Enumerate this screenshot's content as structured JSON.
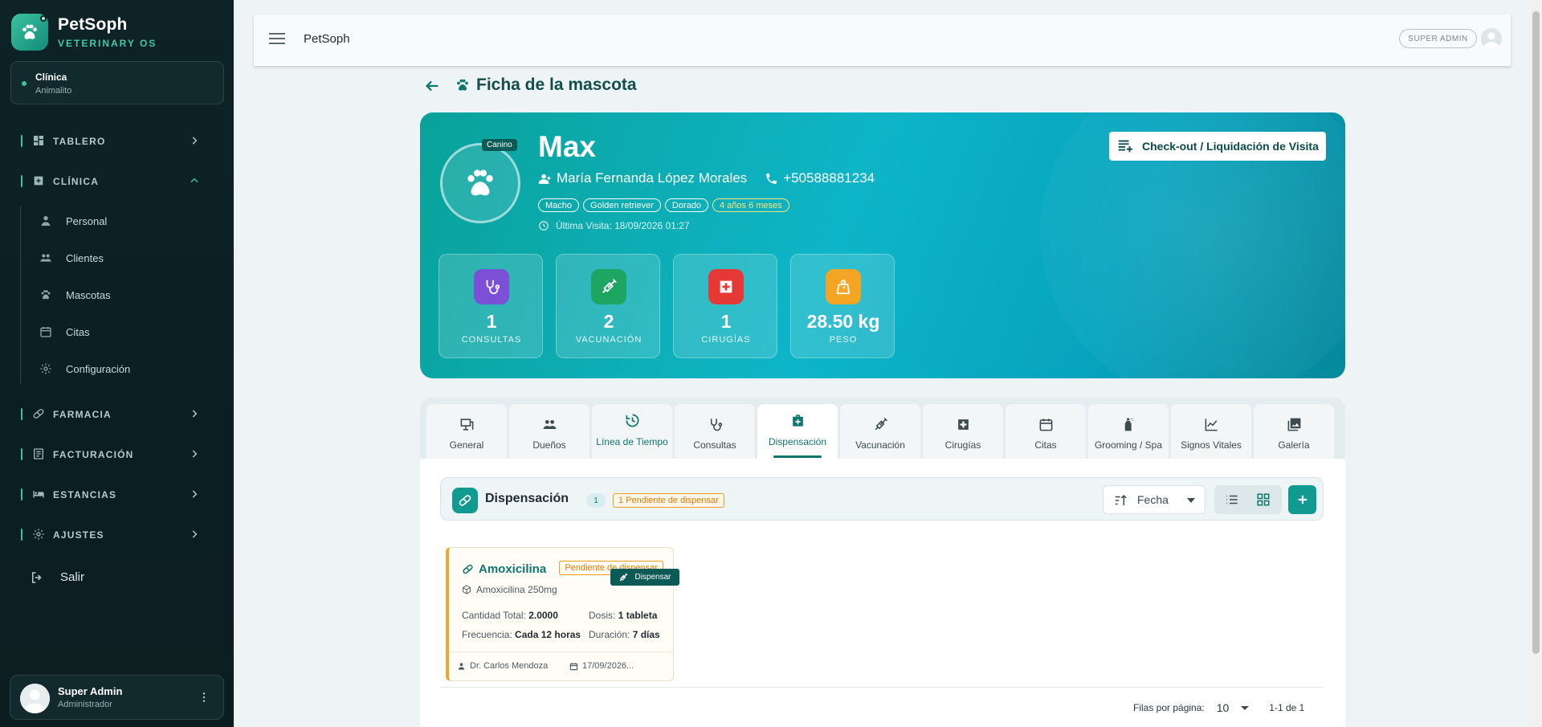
{
  "brand": {
    "name": "PetSoph",
    "subtitle": "VETERINARY OS"
  },
  "clinic": {
    "label": "Clínica",
    "name": "Animalito"
  },
  "sidebar": {
    "sections": [
      {
        "label": "TABLERO",
        "icon": "dashboard-icon",
        "expanded": false
      },
      {
        "label": "CLÍNICA",
        "icon": "medical-icon",
        "expanded": true
      },
      {
        "label": "FARMACIA",
        "icon": "pill-icon",
        "expanded": false
      },
      {
        "label": "FACTURACIÓN",
        "icon": "invoice-icon",
        "expanded": false
      },
      {
        "label": "ESTANCIAS",
        "icon": "bed-icon",
        "expanded": false
      },
      {
        "label": "AJUSTES",
        "icon": "gear-icon",
        "expanded": false
      }
    ],
    "clinic_items": [
      {
        "label": "Personal",
        "icon": "staff-icon"
      },
      {
        "label": "Clientes",
        "icon": "people-icon"
      },
      {
        "label": "Mascotas",
        "icon": "paw-icon"
      },
      {
        "label": "Citas",
        "icon": "calendar-icon"
      },
      {
        "label": "Configuración",
        "icon": "gear-icon"
      }
    ],
    "logout": "Salir"
  },
  "user": {
    "name": "Super Admin",
    "role": "Administrador"
  },
  "topbar": {
    "title": "PetSoph",
    "role_badge": "SUPER ADMIN"
  },
  "page": {
    "title": "Ficha de la mascota"
  },
  "pet": {
    "name": "Max",
    "species": "Canino",
    "owner": "María Fernanda López Morales",
    "phone": "+50588881234",
    "tags": [
      "Macho",
      "Golden retriever",
      "Dorado"
    ],
    "age": "4 años 6 meses",
    "last_visit": "Última Visita: 18/09/2026 01:27"
  },
  "checkout_label": "Check-out / Liquidación de Visita",
  "stats": [
    {
      "value": "1",
      "label": "CONSULTAS",
      "color": "#7b4fd6",
      "icon": "stethoscope-icon"
    },
    {
      "value": "2",
      "label": "VACUNACIÓN",
      "color": "#1fa562",
      "icon": "syringe-icon"
    },
    {
      "value": "1",
      "label": "CIRUGÍAS",
      "color": "#e53935",
      "icon": "medical-cross-icon"
    },
    {
      "value": "28.50 kg",
      "label": "PESO",
      "color": "#f5a524",
      "icon": "weight-icon"
    }
  ],
  "tabs": [
    {
      "label": "General",
      "icon": "info-board-icon"
    },
    {
      "label": "Dueños",
      "icon": "people-icon"
    },
    {
      "label": "Línea de Tiempo",
      "icon": "timeline-icon"
    },
    {
      "label": "Consultas",
      "icon": "stethoscope-icon"
    },
    {
      "label": "Dispensación",
      "icon": "medical-bag-icon"
    },
    {
      "label": "Vacunación",
      "icon": "syringe-icon"
    },
    {
      "label": "Cirugías",
      "icon": "medical-cross-icon"
    },
    {
      "label": "Citas",
      "icon": "calendar-icon"
    },
    {
      "label": "Grooming / Spa",
      "icon": "spray-icon"
    },
    {
      "label": "Signos Vitales",
      "icon": "chart-line-icon"
    },
    {
      "label": "Galería",
      "icon": "gallery-icon"
    }
  ],
  "active_tab": "Dispensación",
  "section": {
    "title": "Dispensación",
    "count": "1",
    "pending": "1 Pendiente de dispensar",
    "sort_label": "Fecha"
  },
  "dispense_card": {
    "title": "Amoxicilina",
    "status": "Pendiente de dispensar",
    "medication": "Amoxicilina 250mg",
    "qty_label": "Cantidad Total:",
    "qty_value": "2.0000",
    "dose_label": "Dosis:",
    "dose_value": "1 tableta",
    "freq_label": "Frecuencia:",
    "freq_value": "Cada 12 horas",
    "duration_label": "Duración:",
    "duration_value": "7 días",
    "doctor": "Dr. Carlos Mendoza",
    "date": "17/09/2026...",
    "action": "Dispensar"
  },
  "pagination": {
    "rows_label": "Filas por página:",
    "rows_value": "10",
    "range": "1-1 de 1"
  }
}
